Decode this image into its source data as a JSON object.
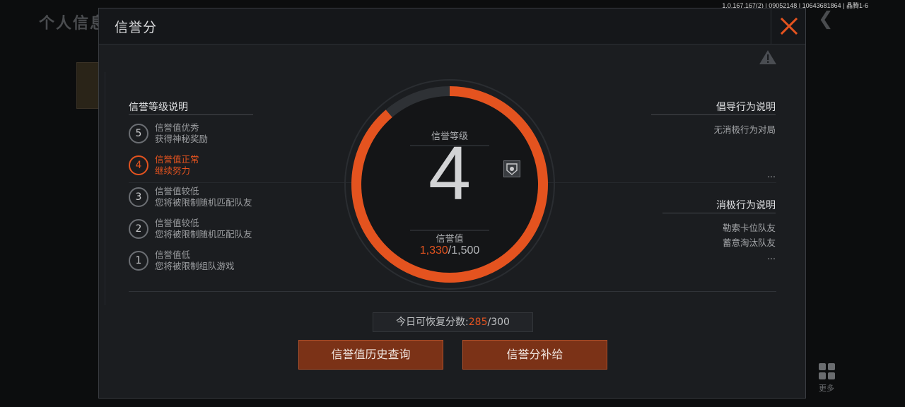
{
  "version": "1.0.167.167(2) | 09052148 | 10643681864 | 晶腾1-6",
  "background": {
    "title": "个人信息",
    "more_label": "更多"
  },
  "modal": {
    "title": "信誉分",
    "levels_title": "信誉等级说明",
    "levels": [
      {
        "num": "5",
        "line1": "信誉值优秀",
        "line2": "获得神秘奖励",
        "active": false
      },
      {
        "num": "4",
        "line1": "信誉值正常",
        "line2": "继续努力",
        "active": true
      },
      {
        "num": "3",
        "line1": "信誉值较低",
        "line2": "您将被限制随机匹配队友",
        "active": false
      },
      {
        "num": "2",
        "line1": "信誉值较低",
        "line2": "您将被限制随机匹配队友",
        "active": false
      },
      {
        "num": "1",
        "line1": "信誉值低",
        "line2": "您将被限制组队游戏",
        "active": false
      }
    ],
    "dial": {
      "level_label": "信誉等级",
      "level": "4",
      "score_label": "信誉值",
      "score_current": "1,330",
      "score_max": "/1,500",
      "progress": 0.887
    },
    "positive": {
      "title": "倡导行为说明",
      "items": [
        "无消极行为对局"
      ],
      "more": "..."
    },
    "negative": {
      "title": "消极行为说明",
      "items": [
        "勒索卡位队友",
        "蓄意淘汰队友"
      ],
      "more": "..."
    },
    "recover": {
      "label": "今日可恢复分数:",
      "current": "285",
      "max": "/300"
    },
    "buttons": {
      "history": "信誉值历史查询",
      "supply": "信誉分补给"
    }
  },
  "colors": {
    "accent": "#e4531f",
    "panel": "#1b1d20",
    "button": "#7b3217"
  }
}
